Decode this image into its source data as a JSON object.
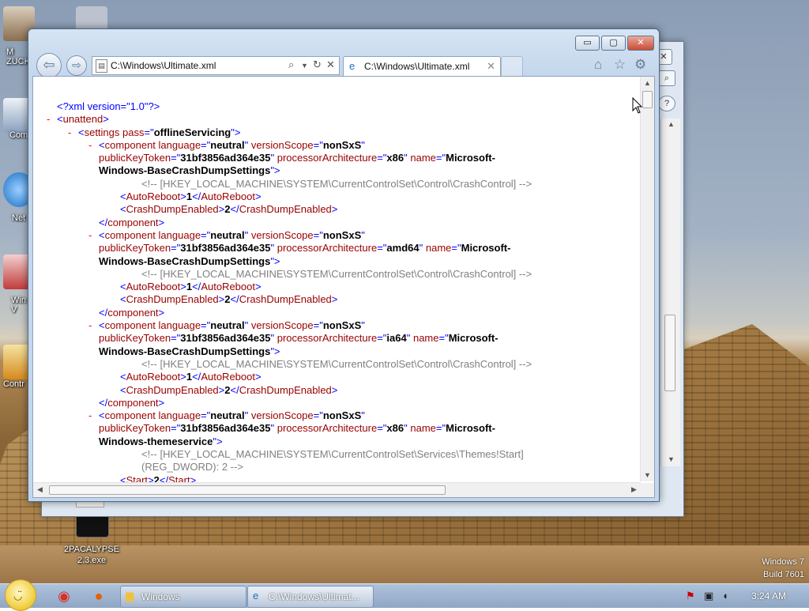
{
  "desktop": {
    "icons": [
      {
        "label": "M\nZUCK",
        "icon": "folder-person-icon"
      },
      {
        "label": "Com",
        "icon": "computer-icon"
      },
      {
        "label": "Net",
        "icon": "network-icon"
      },
      {
        "label": "Win\nV",
        "icon": "recycle-bin-icon"
      },
      {
        "label": "Contr",
        "icon": "control-panel-icon"
      }
    ],
    "exe_label_1": "2PACALYPSE",
    "exe_label_2": "2.3.exe",
    "watermark_line1": "Windows 7",
    "watermark_line2": "Build 7601"
  },
  "browser": {
    "address": "C:\\Windows\\Ultimate.xml",
    "tab_title": "C:\\Windows\\Ultimate.xml",
    "title_buttons": {
      "minimize": "▭",
      "maximize": "▢",
      "close": "✕"
    }
  },
  "xml": {
    "decl": "<?xml version=\"1.0\"?>",
    "root_open": "unattend",
    "settings_pass": "offlineServicing",
    "registry_crash": "<!-- [HKEY_LOCAL_MACHINE\\SYSTEM\\CurrentControlSet\\Control\\CrashControl] -->",
    "registry_themes_1": "<!-- [HKEY_LOCAL_MACHINE\\SYSTEM\\CurrentControlSet\\Services\\Themes!Start]",
    "registry_themes_2": "(REG_DWORD): 2 -->",
    "language": "neutral",
    "versionScope": "nonSxS",
    "publicKeyToken": "31bf3856ad364e35",
    "arch_x86": "x86",
    "arch_amd64": "amd64",
    "arch_ia64": "ia64",
    "name_part1": "Microsoft-",
    "name_crash": "Windows-BaseCrashDumpSettings",
    "name_theme": "Windows-themeservice",
    "autoreboot": "1",
    "crashdump": "2",
    "start": "2"
  },
  "taskbar": {
    "items": [
      {
        "label": "Windows",
        "icon": "folder-icon"
      },
      {
        "label": "C:\\Windows\\Ultimat...",
        "icon": "ie-icon"
      }
    ],
    "pinned": [
      "chrome-icon",
      "firefox-icon"
    ],
    "clock": "3:24 AM"
  }
}
